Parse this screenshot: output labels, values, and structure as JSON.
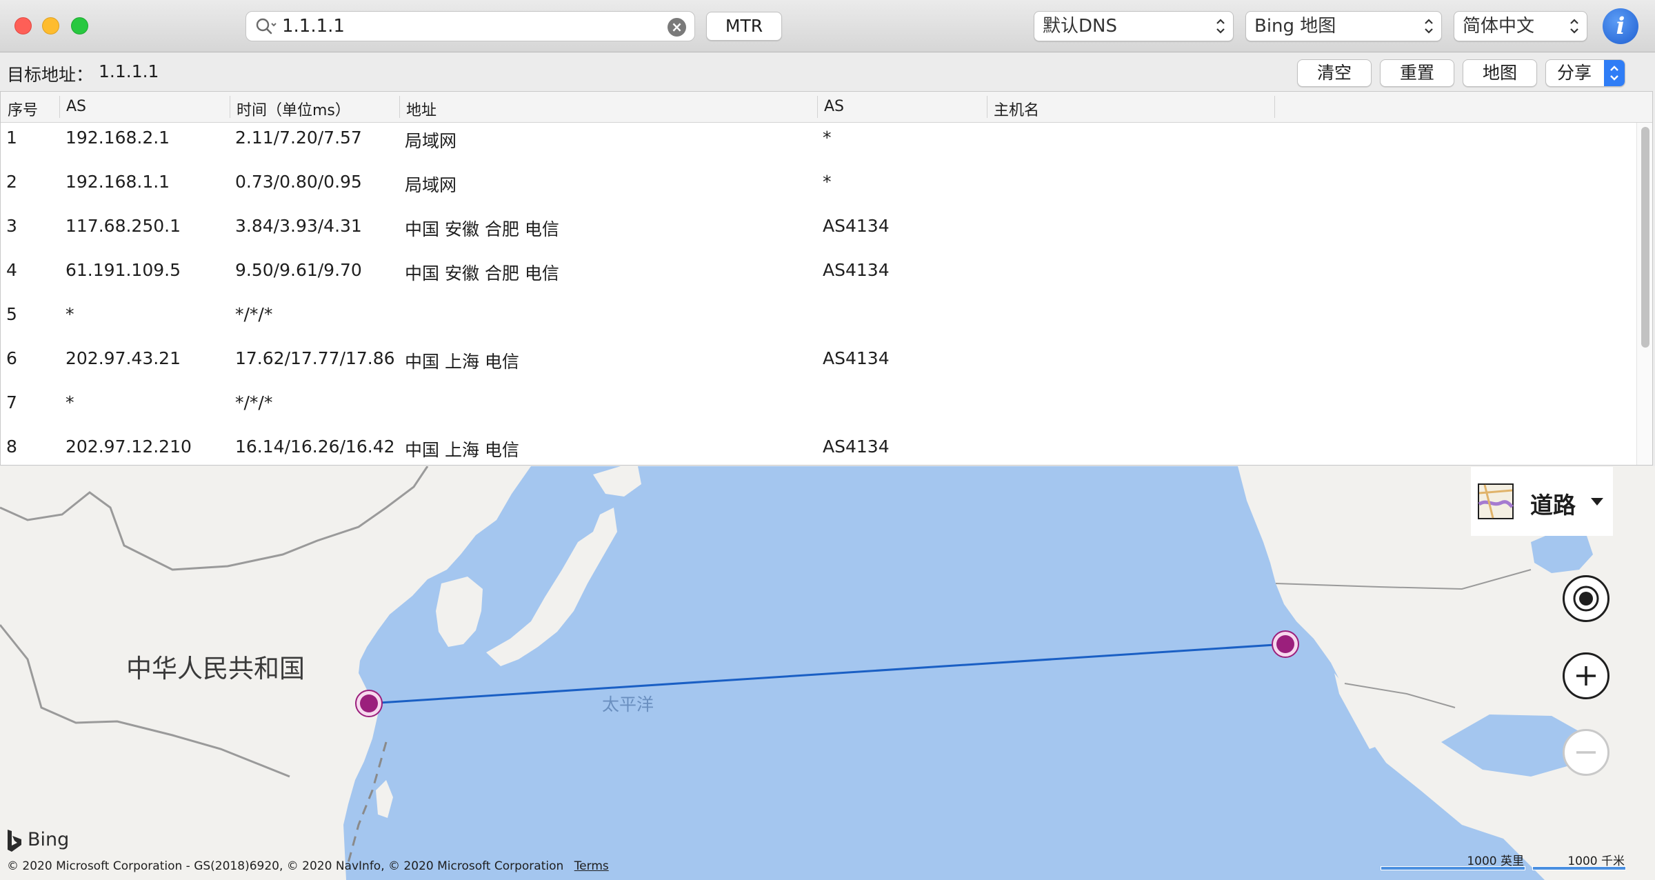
{
  "toolbar": {
    "search_value": "1.1.1.1",
    "mtr_label": "MTR",
    "dns_select": "默认DNS",
    "map_select": "Bing 地图",
    "lang_select": "简体中文",
    "info_label": "i"
  },
  "target": {
    "label": "目标地址：",
    "value": "1.1.1.1"
  },
  "actions": {
    "clear": "清空",
    "reset": "重置",
    "map": "地图",
    "share": "分享"
  },
  "table": {
    "headers": [
      "序号",
      "AS",
      "时间（单位ms）",
      "地址",
      "AS",
      "主机名"
    ],
    "rows": [
      {
        "no": "1",
        "ip": "192.168.2.1",
        "time": "2.11/7.20/7.57",
        "location": "局域网",
        "as": "*",
        "host": ""
      },
      {
        "no": "2",
        "ip": "192.168.1.1",
        "time": "0.73/0.80/0.95",
        "location": "局域网",
        "as": "*",
        "host": ""
      },
      {
        "no": "3",
        "ip": "117.68.250.1",
        "time": "3.84/3.93/4.31",
        "location": "中国 安徽 合肥 电信",
        "as": "AS4134",
        "host": ""
      },
      {
        "no": "4",
        "ip": "61.191.109.5",
        "time": "9.50/9.61/9.70",
        "location": "中国 安徽 合肥 电信",
        "as": "AS4134",
        "host": ""
      },
      {
        "no": "5",
        "ip": "*",
        "time": "*/*/*",
        "location": "",
        "as": "",
        "host": ""
      },
      {
        "no": "6",
        "ip": "202.97.43.21",
        "time": "17.62/17.77/17.86",
        "location": "中国 上海 电信",
        "as": "AS4134",
        "host": ""
      },
      {
        "no": "7",
        "ip": "*",
        "time": "*/*/*",
        "location": "",
        "as": "",
        "host": ""
      },
      {
        "no": "8",
        "ip": "202.97.12.210",
        "time": "16.14/16.26/16.42",
        "location": "中国 上海 电信",
        "as": "AS4134",
        "host": ""
      }
    ]
  },
  "map": {
    "country_label": "中华人民共和国",
    "ocean_label": "太平洋",
    "map_type_label": "道路",
    "bing_label": "Bing",
    "copyright": "© 2020 Microsoft Corporation - GS(2018)6920, © 2020 NavInfo, © 2020 Microsoft Corporation",
    "terms_label": "Terms",
    "scale_miles": "1000 英里",
    "scale_km": "1000 千米",
    "route_color": "#1a5fc4",
    "marker_color": "#9b1f7c"
  }
}
